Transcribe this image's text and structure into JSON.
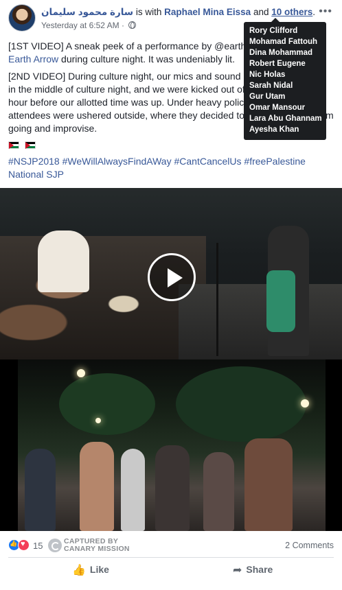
{
  "post": {
    "author": "سارة محمود سليمان",
    "is_with_text": "is with",
    "tagged_user": "Raphael Mina Eissa",
    "and_text": "and",
    "others_link": "10 others",
    "period": ".",
    "timestamp": "Yesterday at 6:52 AM",
    "separator": "·",
    "more_icon": "ellipsis-icon",
    "body": {
      "para1_prefix": "[1ST VIDEO] A sneak peek of a performance by @earth",
      "para1_slash": "/",
      "para1_link": "Earth Arrow",
      "para1_suffix": " during culture night. It was undeniably lit.",
      "para2": "[2ND VIDEO] During culture night, our mics and sound [...] in the middle of culture night, and we were kicked out of [...] hour before our allotted time was up. Under heavy polic[...] attendees were ushered outside, where they decided to [...]m going and improvise.",
      "para2_line1": "[2ND VIDEO] During culture night, our mics and sound",
      "para2_line2": "in the middle of culture night, and we were kicked out of",
      "para2_line3": "hour before our allotted time was up. Under heavy polic",
      "para2_line4": "attendees were ushered outside, where they decided to",
      "para2_line4_tail": "m",
      "para2_line5": "going and improvise."
    },
    "hashtags": [
      "#NSJP2018",
      "#WeWillAlwaysFindAWay",
      "#CantCancelUs",
      "#freePalestine"
    ],
    "page_link": "National SJP"
  },
  "tooltip": {
    "names": [
      "Rory Clifford",
      "Mohamad Fattouh",
      "Dina Mohammad",
      "Robert Eugene",
      "Nic Holas",
      "Sarah Nidal",
      "Gur Utam",
      "Omar Mansour",
      "Lara Abu Ghannam",
      "Ayesha Khan"
    ]
  },
  "reactions": {
    "count": "15",
    "watermark_line1": "CAPTURED BY",
    "watermark_line2": "CANARY MISSION",
    "comments": "2 Comments"
  },
  "actions": {
    "like_label": "Like",
    "share_label": "Share"
  },
  "colors": {
    "link": "#385898",
    "text": "#1d2129",
    "muted": "#606770",
    "tooltip_bg": "#1c1e21",
    "like_blue": "#1877f2",
    "love_red": "#f33e58"
  }
}
